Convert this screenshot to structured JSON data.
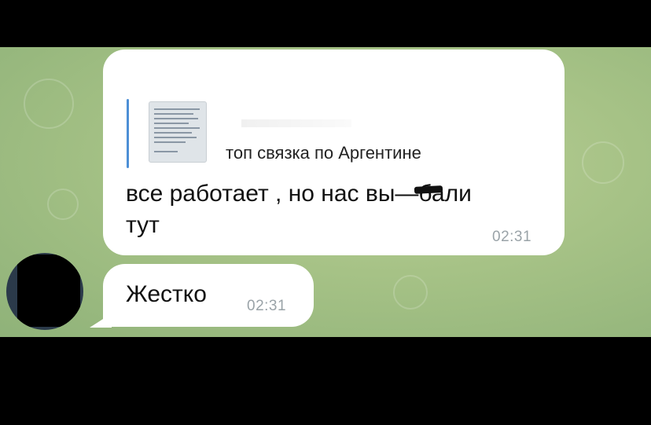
{
  "chat": {
    "background_color": "#a6c286",
    "messages": [
      {
        "reply_preview_text": "топ связка по Аргентине",
        "text": "все работает , но нас вы—бали\nтут",
        "time": "02:31"
      },
      {
        "text": "Жестко",
        "time": "02:31"
      }
    ],
    "accent_color": "#4d8fd6"
  }
}
